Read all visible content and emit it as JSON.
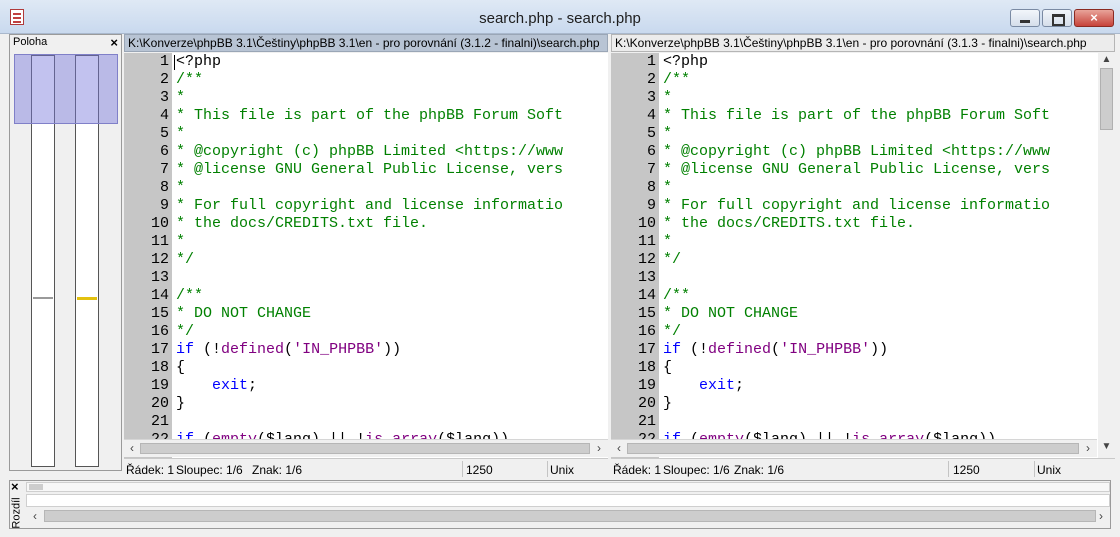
{
  "window": {
    "title": "search.php - search.php"
  },
  "poloha": {
    "label": "Poloha",
    "close": "×"
  },
  "rozdil": {
    "label": "Rozdíl",
    "close": "×"
  },
  "icons": {
    "close": "×",
    "scroll_left": "‹",
    "scroll_right": "›",
    "scroll_up": "▲",
    "scroll_down": "▼"
  },
  "left_pane": {
    "path": "K:\\Konverze\\phpBB 3.1\\Češtiny\\phpBB 3.1\\en - pro porovnání (3.1.2 - finalni)\\search.php",
    "status": {
      "row": "Řádek: 1",
      "col": "Sloupec: 1/6",
      "char": "Znak: 1/6",
      "size": "1250",
      "eol": "Unix"
    }
  },
  "right_pane": {
    "path": "K:\\Konverze\\phpBB 3.1\\Češtiny\\phpBB 3.1\\en - pro porovnání (3.1.3 - finalni)\\search.php",
    "status": {
      "row": "Řádek: 1",
      "col": "Sloupec: 1/6",
      "char": "Znak: 1/6",
      "size": "1250",
      "eol": "Unix"
    }
  },
  "code_lines": [
    {
      "n": "1",
      "tokens": [
        {
          "t": "<?php",
          "c": "plain"
        }
      ]
    },
    {
      "n": "2",
      "tokens": [
        {
          "t": "/**",
          "c": "comment"
        }
      ]
    },
    {
      "n": "3",
      "tokens": [
        {
          "t": "*",
          "c": "comment"
        }
      ]
    },
    {
      "n": "4",
      "tokens": [
        {
          "t": "* This file is part of the phpBB Forum Soft",
          "c": "comment"
        }
      ]
    },
    {
      "n": "5",
      "tokens": [
        {
          "t": "*",
          "c": "comment"
        }
      ]
    },
    {
      "n": "6",
      "tokens": [
        {
          "t": "* @copyright (c) phpBB Limited <https://www",
          "c": "comment"
        }
      ]
    },
    {
      "n": "7",
      "tokens": [
        {
          "t": "* @license GNU General Public License, vers",
          "c": "comment"
        }
      ]
    },
    {
      "n": "8",
      "tokens": [
        {
          "t": "*",
          "c": "comment"
        }
      ]
    },
    {
      "n": "9",
      "tokens": [
        {
          "t": "* For full copyright and license informatio",
          "c": "comment"
        }
      ]
    },
    {
      "n": "10",
      "tokens": [
        {
          "t": "* the docs/CREDITS.txt file.",
          "c": "comment"
        }
      ]
    },
    {
      "n": "11",
      "tokens": [
        {
          "t": "*",
          "c": "comment"
        }
      ]
    },
    {
      "n": "12",
      "tokens": [
        {
          "t": "*/",
          "c": "comment"
        }
      ]
    },
    {
      "n": "13",
      "tokens": [
        {
          "t": "",
          "c": "plain"
        }
      ]
    },
    {
      "n": "14",
      "tokens": [
        {
          "t": "/**",
          "c": "comment"
        }
      ]
    },
    {
      "n": "15",
      "tokens": [
        {
          "t": "* DO NOT CHANGE",
          "c": "comment"
        }
      ]
    },
    {
      "n": "16",
      "tokens": [
        {
          "t": "*/",
          "c": "comment"
        }
      ]
    },
    {
      "n": "17",
      "tokens": [
        {
          "t": "if",
          "c": "kw"
        },
        {
          "t": " (!",
          "c": "plain"
        },
        {
          "t": "defined",
          "c": "fn"
        },
        {
          "t": "(",
          "c": "plain"
        },
        {
          "t": "'IN_PHPBB'",
          "c": "str"
        },
        {
          "t": "))",
          "c": "plain"
        }
      ]
    },
    {
      "n": "18",
      "tokens": [
        {
          "t": "{",
          "c": "plain"
        }
      ]
    },
    {
      "n": "19",
      "tokens": [
        {
          "t": "    ",
          "c": "plain"
        },
        {
          "t": "exit",
          "c": "kw"
        },
        {
          "t": ";",
          "c": "plain"
        }
      ]
    },
    {
      "n": "20",
      "tokens": [
        {
          "t": "}",
          "c": "plain"
        }
      ]
    },
    {
      "n": "21",
      "tokens": [
        {
          "t": "",
          "c": "plain"
        }
      ]
    },
    {
      "n": "22",
      "tokens": [
        {
          "t": "if",
          "c": "kw"
        },
        {
          "t": " (",
          "c": "plain"
        },
        {
          "t": "empty",
          "c": "fn"
        },
        {
          "t": "($lang) || !",
          "c": "plain"
        },
        {
          "t": "is_array",
          "c": "fn"
        },
        {
          "t": "($lang))",
          "c": "plain"
        }
      ]
    }
  ]
}
